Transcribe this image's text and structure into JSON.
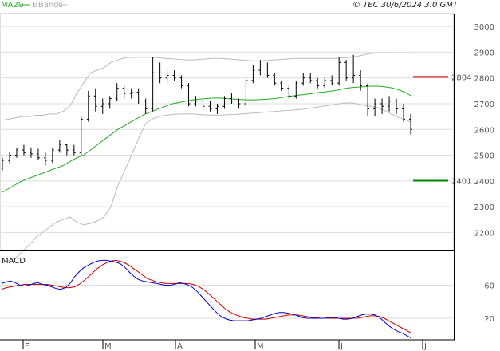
{
  "header": {
    "legend_ma": "MA20",
    "legend_bb": "BBands",
    "source": "© TEC 30/6/2024 3:0 GMT"
  },
  "colors": {
    "price": "#000000",
    "ma20": "#22aa22",
    "bbands": "#bbbbbb",
    "resistance": "#cc0000",
    "support": "#008800",
    "macd": "#0000cc",
    "signal": "#cc0000",
    "grid": "#dddddd"
  },
  "chart_data": [
    {
      "type": "line",
      "title": "",
      "x_ticks": [
        "F",
        "M",
        "A",
        "M",
        "J",
        "J"
      ],
      "ylim": [
        2130,
        3050
      ],
      "y_ticks": [
        2200,
        2300,
        2400,
        2500,
        2600,
        2700,
        2800,
        2900,
        3000
      ],
      "levels": [
        {
          "name": "resistance",
          "value": 2804,
          "label": "2804"
        },
        {
          "name": "support",
          "value": 2401,
          "label": "2401"
        }
      ],
      "series": [
        {
          "name": "MA20",
          "values": [
            2355,
            2370,
            2385,
            2400,
            2410,
            2420,
            2430,
            2440,
            2450,
            2460,
            2475,
            2490,
            2500,
            2520,
            2540,
            2560,
            2580,
            2600,
            2615,
            2630,
            2645,
            2660,
            2670,
            2680,
            2690,
            2700,
            2705,
            2710,
            2715,
            2718,
            2720,
            2722,
            2722,
            2720,
            2718,
            2716,
            2715,
            2715,
            2716,
            2718,
            2720,
            2724,
            2728,
            2732,
            2735,
            2738,
            2742,
            2745,
            2748,
            2752,
            2758,
            2762,
            2764,
            2766,
            2768,
            2768,
            2766,
            2762,
            2755,
            2745,
            2730
          ]
        },
        {
          "name": "BBands",
          "values": [
            2635,
            2640,
            2645,
            2650,
            2650,
            2655,
            2655,
            2660,
            2660,
            2670,
            2690,
            2740,
            2780,
            2820,
            2830,
            2840,
            2860,
            2870,
            2878,
            2880,
            2880,
            2880,
            2880,
            2878,
            2876,
            2874,
            2872,
            2870,
            2870,
            2872,
            2874,
            2876,
            2876,
            2874,
            2872,
            2870,
            2868,
            2866,
            2866,
            2868,
            2870,
            2872,
            2874,
            2876,
            2876,
            2876,
            2876,
            2876,
            2876,
            2876,
            2878,
            2880,
            2884,
            2890,
            2895,
            2897,
            2898,
            2897,
            2897,
            2897,
            2897
          ]
        },
        {
          "name": "BBands lower",
          "values": [
            2080,
            2090,
            2100,
            2125,
            2150,
            2180,
            2200,
            2220,
            2240,
            2250,
            2260,
            2240,
            2230,
            2235,
            2245,
            2260,
            2300,
            2380,
            2440,
            2500,
            2560,
            2620,
            2640,
            2650,
            2655,
            2658,
            2660,
            2660,
            2660,
            2658,
            2656,
            2656,
            2656,
            2657,
            2658,
            2660,
            2662,
            2664,
            2666,
            2668,
            2670,
            2672,
            2674,
            2676,
            2678,
            2682,
            2686,
            2690,
            2694,
            2698,
            2702,
            2704,
            2700,
            2694,
            2690,
            2685,
            2675,
            2660,
            2648,
            2638,
            2628
          ]
        }
      ],
      "ohlc": [
        [
          2450,
          2490,
          2440,
          2480
        ],
        [
          2480,
          2510,
          2470,
          2500
        ],
        [
          2500,
          2530,
          2490,
          2520
        ],
        [
          2520,
          2540,
          2500,
          2510
        ],
        [
          2510,
          2530,
          2490,
          2505
        ],
        [
          2505,
          2525,
          2480,
          2490
        ],
        [
          2490,
          2510,
          2460,
          2480
        ],
        [
          2480,
          2530,
          2470,
          2520
        ],
        [
          2520,
          2560,
          2510,
          2540
        ],
        [
          2540,
          2545,
          2500,
          2520
        ],
        [
          2520,
          2540,
          2500,
          2510
        ],
        [
          2510,
          2650,
          2500,
          2640
        ],
        [
          2640,
          2750,
          2630,
          2730
        ],
        [
          2730,
          2760,
          2670,
          2690
        ],
        [
          2690,
          2720,
          2660,
          2700
        ],
        [
          2700,
          2730,
          2680,
          2720
        ],
        [
          2720,
          2780,
          2710,
          2760
        ],
        [
          2760,
          2770,
          2720,
          2740
        ],
        [
          2740,
          2760,
          2720,
          2745
        ],
        [
          2745,
          2760,
          2700,
          2710
        ],
        [
          2710,
          2720,
          2660,
          2680
        ],
        [
          2680,
          2880,
          2670,
          2820
        ],
        [
          2820,
          2860,
          2780,
          2800
        ],
        [
          2800,
          2830,
          2780,
          2810
        ],
        [
          2810,
          2830,
          2790,
          2800
        ],
        [
          2800,
          2810,
          2760,
          2770
        ],
        [
          2770,
          2780,
          2690,
          2700
        ],
        [
          2700,
          2730,
          2690,
          2710
        ],
        [
          2710,
          2720,
          2680,
          2690
        ],
        [
          2690,
          2710,
          2670,
          2680
        ],
        [
          2680,
          2700,
          2660,
          2690
        ],
        [
          2690,
          2730,
          2680,
          2720
        ],
        [
          2720,
          2740,
          2700,
          2710
        ],
        [
          2710,
          2720,
          2680,
          2700
        ],
        [
          2700,
          2800,
          2690,
          2790
        ],
        [
          2790,
          2850,
          2780,
          2830
        ],
        [
          2830,
          2870,
          2810,
          2850
        ],
        [
          2850,
          2860,
          2800,
          2810
        ],
        [
          2810,
          2820,
          2770,
          2780
        ],
        [
          2780,
          2790,
          2750,
          2760
        ],
        [
          2760,
          2770,
          2720,
          2730
        ],
        [
          2730,
          2790,
          2720,
          2780
        ],
        [
          2780,
          2820,
          2770,
          2800
        ],
        [
          2800,
          2820,
          2780,
          2790
        ],
        [
          2790,
          2800,
          2760,
          2770
        ],
        [
          2770,
          2800,
          2760,
          2790
        ],
        [
          2790,
          2810,
          2770,
          2780
        ],
        [
          2780,
          2880,
          2770,
          2860
        ],
        [
          2860,
          2870,
          2790,
          2800
        ],
        [
          2800,
          2890,
          2780,
          2810
        ],
        [
          2810,
          2830,
          2750,
          2770
        ],
        [
          2770,
          2780,
          2650,
          2680
        ],
        [
          2680,
          2720,
          2650,
          2700
        ],
        [
          2700,
          2720,
          2660,
          2690
        ],
        [
          2690,
          2730,
          2670,
          2710
        ],
        [
          2710,
          2720,
          2660,
          2680
        ],
        [
          2680,
          2700,
          2630,
          2640
        ],
        [
          2640,
          2660,
          2580,
          2600
        ]
      ]
    },
    {
      "type": "line",
      "title": "MACD",
      "ylim": [
        -6,
        100
      ],
      "y_ticks": [
        20,
        60
      ],
      "series": [
        {
          "name": "macd",
          "values": [
            62,
            64,
            65,
            63,
            60,
            59,
            60,
            62,
            63,
            61,
            60,
            58,
            56,
            55,
            57,
            62,
            70,
            76,
            81,
            84,
            87,
            89,
            90,
            90,
            89,
            88,
            86,
            82,
            76,
            71,
            67,
            65,
            64,
            63,
            62,
            61,
            60,
            60,
            61,
            63,
            62,
            60,
            57,
            52,
            46,
            40,
            34,
            28,
            23,
            20,
            18,
            17,
            17,
            17,
            17,
            18,
            19,
            20,
            22,
            24,
            26,
            27,
            27,
            26,
            25,
            23,
            21,
            20,
            20,
            20,
            20,
            20,
            21,
            21,
            20,
            19,
            19,
            20,
            22,
            24,
            25,
            25,
            24,
            21,
            16,
            11,
            7,
            4,
            2,
            -1,
            -4
          ]
        },
        {
          "name": "signal",
          "values": [
            55,
            57,
            58,
            59,
            60,
            61,
            61,
            61,
            61,
            61,
            61,
            60,
            59,
            58,
            57,
            57,
            58,
            61,
            65,
            70,
            75,
            80,
            84,
            87,
            89,
            90,
            89,
            87,
            84,
            80,
            76,
            72,
            68,
            66,
            64,
            63,
            62,
            62,
            62,
            62,
            62,
            62,
            61,
            59,
            56,
            52,
            47,
            42,
            37,
            32,
            28,
            25,
            23,
            21,
            20,
            19,
            19,
            19,
            19,
            20,
            21,
            22,
            23,
            24,
            24,
            24,
            23,
            22,
            21,
            21,
            20,
            20,
            20,
            20,
            20,
            20,
            20,
            20,
            20,
            21,
            22,
            23,
            23,
            22,
            20,
            17,
            14,
            11,
            8,
            5,
            2
          ]
        }
      ]
    }
  ]
}
